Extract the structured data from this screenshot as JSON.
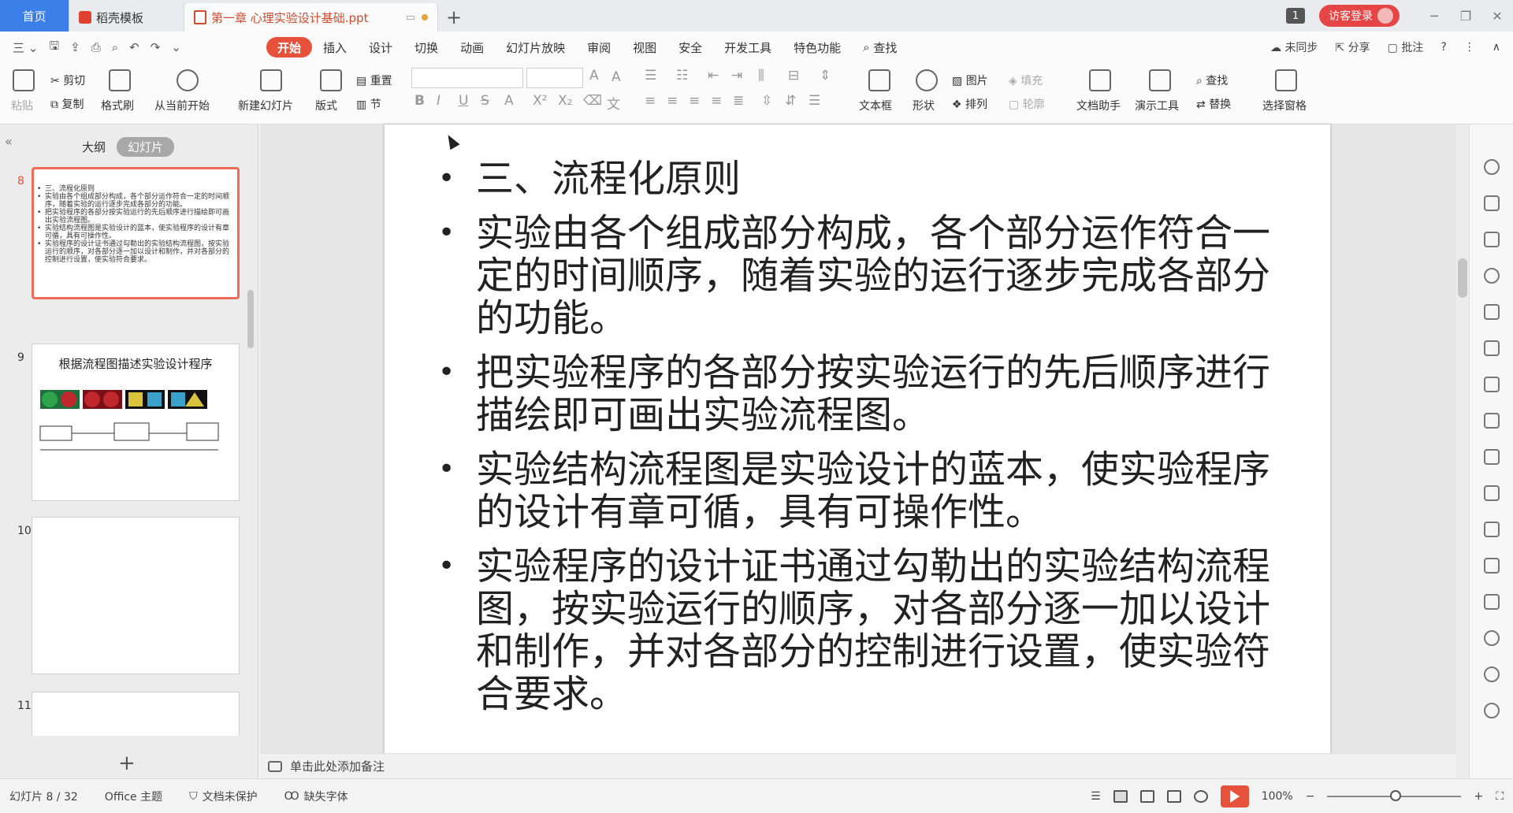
{
  "titlebar": {
    "home_tab": "首页",
    "template_tab": "稻壳模板",
    "doc_tab": "第一章 心理实验设计基础.ppt",
    "new_tab": "+",
    "badge": "1",
    "login": "访客登录",
    "window": {
      "minimize": "─",
      "restore": "❐",
      "close": "✕"
    }
  },
  "menubar": {
    "left_menu": "三 ⌄",
    "items": [
      "开始",
      "插入",
      "设计",
      "切换",
      "动画",
      "幻灯片放映",
      "审阅",
      "视图",
      "安全",
      "开发工具",
      "特色功能",
      "查找"
    ],
    "active": "开始",
    "right": {
      "sync": "未同步",
      "share": "分享",
      "annotate": "批注",
      "help": "?"
    }
  },
  "ribbon": {
    "paste": "粘贴",
    "cut": "剪切",
    "copy": "复制",
    "format_painter": "格式刷",
    "from_current": "从当前开始",
    "new_slide": "新建幻灯片",
    "layout": "版式",
    "reset": "重置",
    "section": "节",
    "textbox": "文本框",
    "shape": "形状",
    "picture": "图片",
    "arrange": "排列",
    "fill": "填充",
    "outline": "轮廓",
    "doc_assistant": "文档助手",
    "presentation_tools": "演示工具",
    "find": "查找",
    "replace": "替换",
    "selection_pane": "选择窗格"
  },
  "leftpanel": {
    "tab_outline": "大纲",
    "tab_slides": "幻灯片",
    "slides": [
      {
        "num": "8",
        "selected": true,
        "lines": [
          "三、流程化原则",
          "实验由各个组成部分构成，各个部分运作符合一定的时间顺序，随着实验的运行逐步完成各部分的功能。",
          "把实验程序的各部分按实验运行的先后顺序进行描绘即可画出实验流程图。",
          "实验结构流程图是实验设计的蓝本，使实验程序的设计有章可循，具有可操作性。",
          "实验程序的设计证书通过勾勒出的实验结构流程图，按实验运行的顺序，对各部分逐一加以设计和制作，并对各部分的控制进行设置，使实验符合要求。"
        ]
      },
      {
        "num": "9",
        "selected": false,
        "title": "根据流程图描述实验设计程序"
      },
      {
        "num": "10",
        "selected": false
      },
      {
        "num": "11",
        "selected": false
      }
    ],
    "add": "+"
  },
  "slide": {
    "bullets": [
      "三、流程化原则",
      "实验由各个组成部分构成，各个部分运作符合一定的时间顺序，随着实验的运行逐步完成各部分的功能。",
      "把实验程序的各部分按实验运行的先后顺序进行描绘即可画出实验流程图。",
      "实验结构流程图是实验设计的蓝本，使实验程序的设计有章可循，具有可操作性。",
      "实验程序的设计证书通过勾勒出的实验结构流程图，按实验运行的顺序，对各部分逐一加以设计和制作，并对各部分的控制进行设置，使实验符合要求。"
    ]
  },
  "notes": {
    "placeholder": "单击此处添加备注"
  },
  "statusbar": {
    "slide_pos": "幻灯片 8 / 32",
    "theme": "Office 主题",
    "protect": "文档未保护",
    "missing_font": "缺失字体",
    "zoom": "100%",
    "zoom_minus": "−",
    "zoom_plus": "+"
  },
  "colors": {
    "accent": "#e5513b",
    "home_tab": "#3d7fe8"
  }
}
